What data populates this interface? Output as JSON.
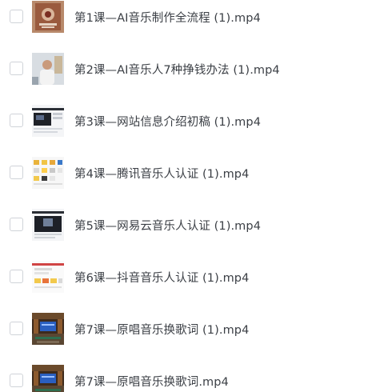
{
  "files": [
    {
      "name": "第1课—AI音乐制作全流程 (1).mp4",
      "thumbnail": "book-cover-thumbnail"
    },
    {
      "name": "第2课—AI音乐人7种挣钱办法 (1).mp4",
      "thumbnail": "person-video-thumbnail"
    },
    {
      "name": "第3课—网站信息介绍初稿 (1).mp4",
      "thumbnail": "website-screenshot-thumbnail"
    },
    {
      "name": "第4课—腾讯音乐人认证 (1).mp4",
      "thumbnail": "app-grid-thumbnail"
    },
    {
      "name": "第5课—网易云音乐人认证 (1).mp4",
      "thumbnail": "website-screenshot-thumbnail"
    },
    {
      "name": "第6课—抖音音乐人认证 (1).mp4",
      "thumbnail": "app-grid-thumbnail"
    },
    {
      "name": "第7课—原唱音乐换歌词 (1).mp4",
      "thumbnail": "stage-scene-thumbnail"
    },
    {
      "name": "第7课—原唱音乐换歌词.mp4",
      "thumbnail": "stage-scene-thumbnail"
    }
  ]
}
